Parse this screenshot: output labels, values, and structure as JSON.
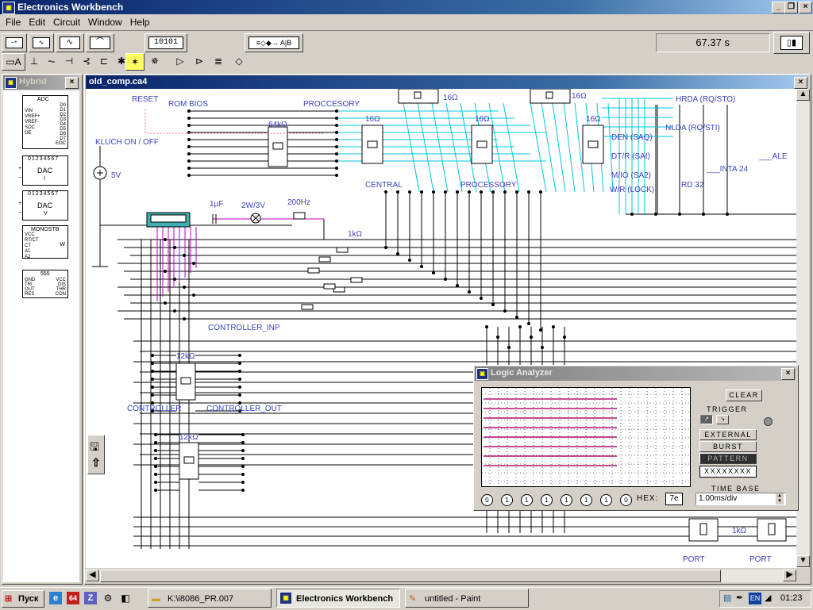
{
  "app": {
    "title": "Electronics Workbench"
  },
  "menu": [
    "File",
    "Edit",
    "Circuit",
    "Window",
    "Help"
  ],
  "toolbar": {
    "simulation_time": "67.37 s"
  },
  "parts_bin": {
    "title": "Hybrid",
    "items": [
      {
        "name": "ADC",
        "pins": [
          "VIN",
          "VREF+",
          "VREF-",
          "SOC",
          "OE",
          "D0",
          "D1",
          "D2",
          "D3",
          "D4",
          "D5",
          "D6",
          "D7",
          "EOC"
        ]
      },
      {
        "name": "DAC",
        "sub": "I",
        "pins": "01234567"
      },
      {
        "name": "DAC",
        "sub": "V",
        "pins": "01234567"
      },
      {
        "name": "MONOSTB",
        "pins": [
          "VCC",
          "RT/CT",
          "CT",
          "A1",
          "A2",
          "W"
        ]
      },
      {
        "name": "555",
        "pins": [
          "GND",
          "VCC",
          "TRI",
          "DIS",
          "OUT",
          "THR",
          "RES",
          "CON"
        ]
      }
    ]
  },
  "circuit": {
    "title": "old_comp.ca4",
    "labels": {
      "reset": "RESET",
      "rom_bios": "ROM BIOS",
      "proccesory": "PROCCESORY",
      "kluch": "KLUCH  ON / OFF",
      "v5": "5V",
      "r64k": "64kΩ",
      "r16_1": "16Ω",
      "r16_2": "16Ω",
      "r16_3": "16Ω",
      "r16_4": "16Ω",
      "r16_5": "16Ω",
      "central": "CENTRAL",
      "processory": "PROCESSORY",
      "hrda": "HRDA (RQ/STO)",
      "nlda": "NLDA (RQ/STI)",
      "den": "DEN (SAQ)",
      "dtr": "DT/R (SAI)",
      "mio": "M/IO (SA2)",
      "wr": "W/R (LOCK)",
      "rd": "RD  32",
      "inta": "___INTA  24",
      "ale": "___ALE",
      "cap": "1µF",
      "lamp": "2W/3V",
      "buzzer": "200Hz",
      "r1k": "1kΩ",
      "r1k_small": "1kΩ",
      "ctrl_inp": "CONTROLLER_INP",
      "r12k_1": "12kΩ",
      "controller": "CONTROLLER",
      "ctrl_out": "CONTROLLER_OUT",
      "r12k_2": "12kΩ",
      "r1k_port": "1kΩ",
      "port1": "PORT",
      "port2": "PORT"
    }
  },
  "logic_analyzer": {
    "title": "Logic Analyzer",
    "clear": "CLEAR",
    "trigger": "TRIGGER",
    "external": "EXTERNAL",
    "burst": "BURST",
    "pattern": "PATTERN",
    "pattern_value": "XXXXXXXX",
    "time_base": "TIME BASE",
    "time_base_value": "1.00ms/div",
    "bits": [
      "0",
      "1",
      "1",
      "1",
      "1",
      "1",
      "1",
      "0"
    ],
    "hex_label": "HEX:",
    "hex_value": "7e",
    "colors": {
      "trace": "#b01070",
      "screen": "#ffffff"
    }
  },
  "taskbar": {
    "start": "Пуск",
    "tasks": [
      {
        "label": "K:\\i8086_PR.007"
      },
      {
        "label": "Electronics Workbench"
      },
      {
        "label": "untitled - Paint"
      }
    ],
    "lang": "EN",
    "clock": "01:23"
  },
  "colors": {
    "wire": "#000000",
    "bus": "#00c8e0",
    "magenta": "#c000c0",
    "pink": "#e08080",
    "label": "#4040c0"
  }
}
